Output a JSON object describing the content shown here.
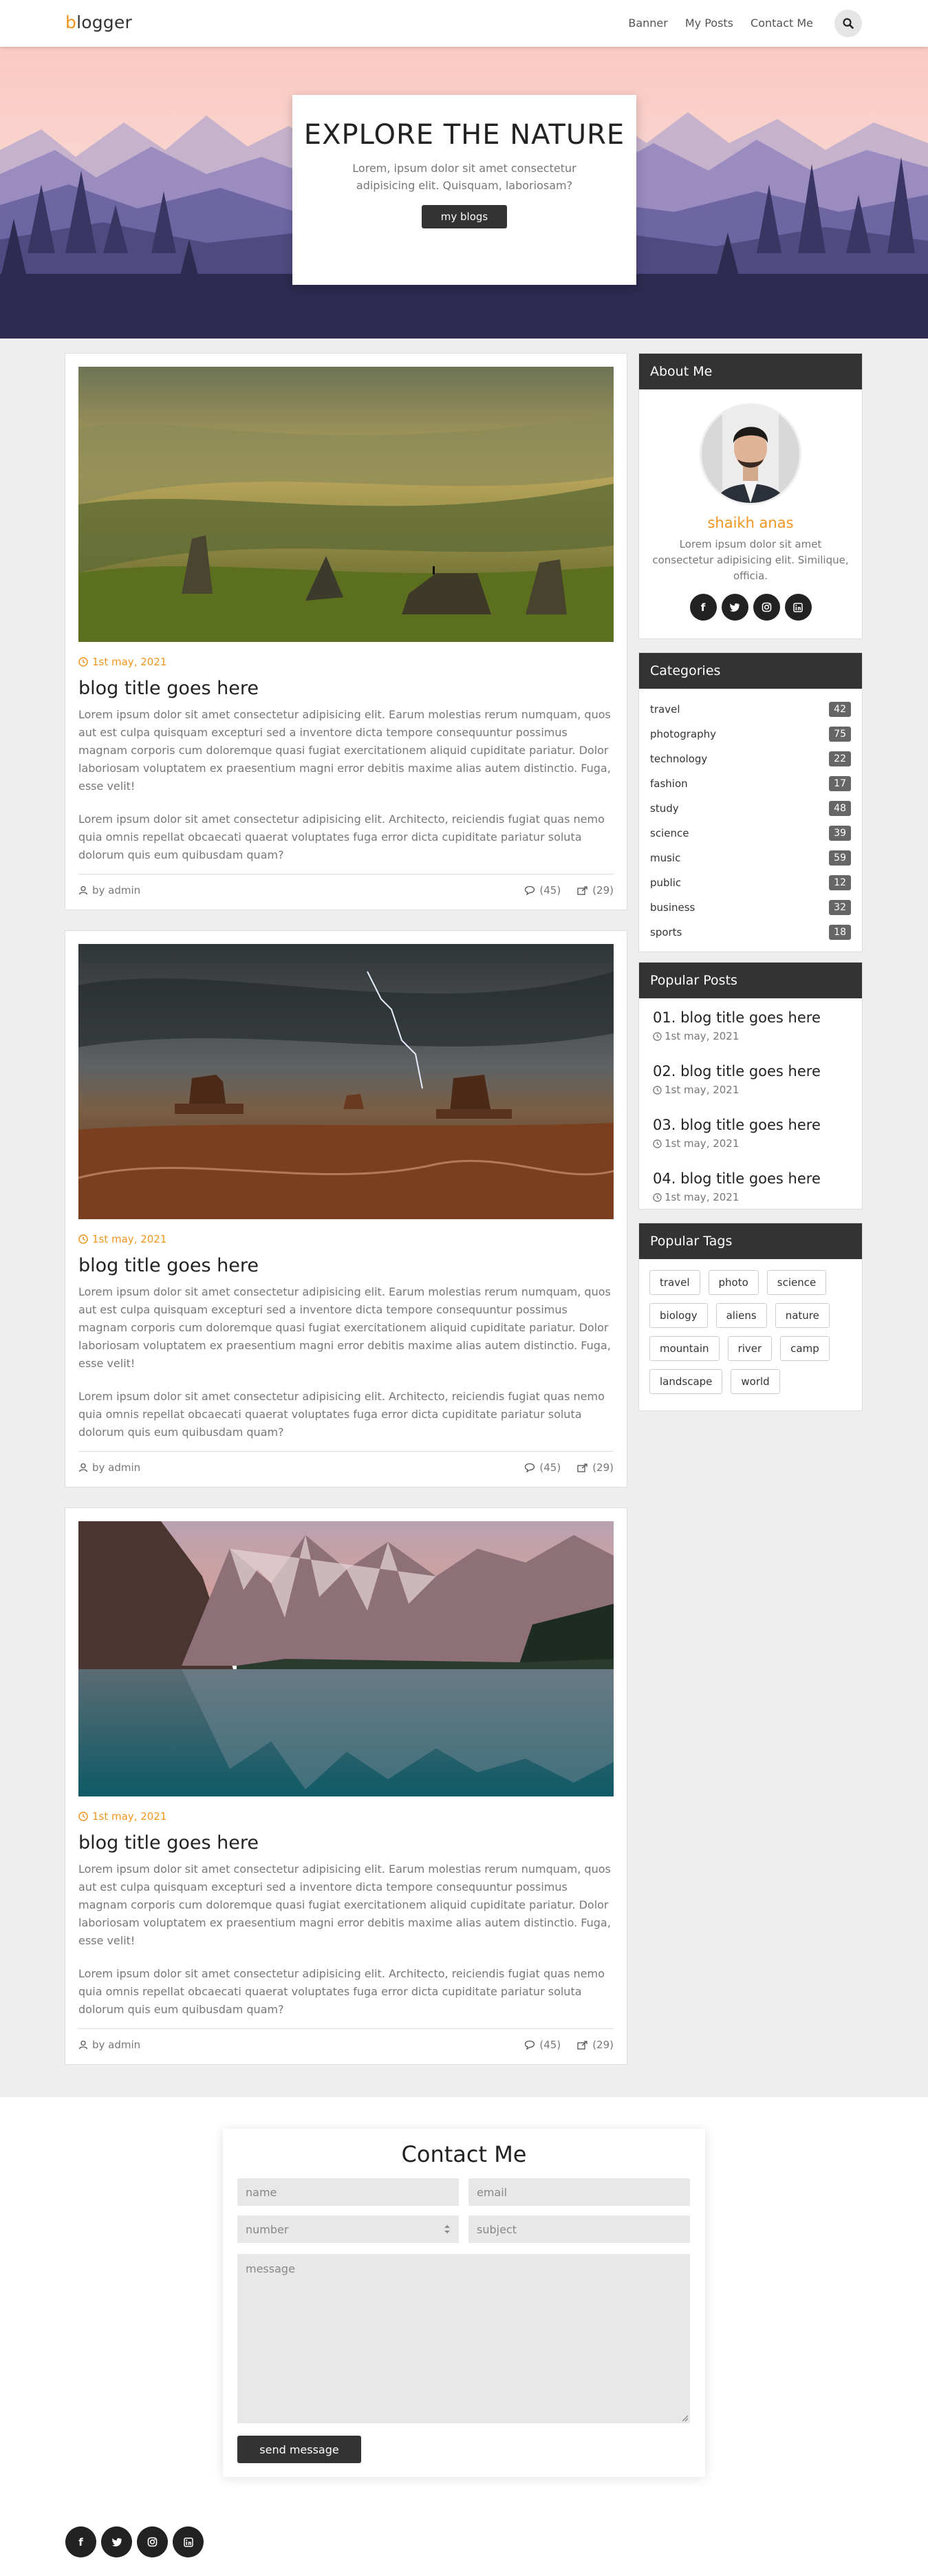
{
  "brand": {
    "first_letter": "b",
    "rest": "logger",
    "accent": "#f0961e"
  },
  "nav": {
    "links": [
      "Banner",
      "My Posts",
      "Contact Me"
    ],
    "search_icon": "search-icon"
  },
  "hero": {
    "title": "EXPLORE THE NATURE",
    "subtitle": "Lorem, ipsum dolor sit amet consectetur adipisicing elit. Quisquam, laboriosam?",
    "button": "my blogs"
  },
  "posts": [
    {
      "date": "1st may, 2021",
      "title": "blog title goes here",
      "p1": "Lorem ipsum dolor sit amet consectetur adipisicing elit. Earum molestias rerum numquam, quos aut est culpa quisquam excepturi sed a inventore dicta tempore consequuntur possimus magnam corporis cum doloremque quasi fugiat exercitationem aliquid cupiditate pariatur. Dolor laboriosam voluptatem ex praesentium magni error debitis maxime alias autem distinctio. Fuga, esse velit!",
      "p2": "Lorem ipsum dolor sit amet consectetur adipisicing elit. Architecto, reiciendis fugiat quas nemo quia omnis repellat obcaecati quaerat voluptates fuga error dicta cupiditate pariatur soluta dolorum quis eum quibusdam quam?",
      "author": "by admin",
      "comments": "(45)",
      "shares": "(29)",
      "image": "landscape-photo-valley"
    },
    {
      "date": "1st may, 2021",
      "title": "blog title goes here",
      "p1": "Lorem ipsum dolor sit amet consectetur adipisicing elit. Earum molestias rerum numquam, quos aut est culpa quisquam excepturi sed a inventore dicta tempore consequuntur possimus magnam corporis cum doloremque quasi fugiat exercitationem aliquid cupiditate pariatur. Dolor laboriosam voluptatem ex praesentium magni error debitis maxime alias autem distinctio. Fuga, esse velit!",
      "p2": "Lorem ipsum dolor sit amet consectetur adipisicing elit. Architecto, reiciendis fugiat quas nemo quia omnis repellat obcaecati quaerat voluptates fuga error dicta cupiditate pariatur soluta dolorum quis eum quibusdam quam?",
      "author": "by admin",
      "comments": "(45)",
      "shares": "(29)",
      "image": "desert-storm-photo"
    },
    {
      "date": "1st may, 2021",
      "title": "blog title goes here",
      "p1": "Lorem ipsum dolor sit amet consectetur adipisicing elit. Earum molestias rerum numquam, quos aut est culpa quisquam excepturi sed a inventore dicta tempore consequuntur possimus magnam corporis cum doloremque quasi fugiat exercitationem aliquid cupiditate pariatur. Dolor laboriosam voluptatem ex praesentium magni error debitis maxime alias autem distinctio. Fuga, esse velit!",
      "p2": "Lorem ipsum dolor sit amet consectetur adipisicing elit. Architecto, reiciendis fugiat quas nemo quia omnis repellat obcaecati quaerat voluptates fuga error dicta cupiditate pariatur soluta dolorum quis eum quibusdam quam?",
      "author": "by admin",
      "comments": "(45)",
      "shares": "(29)",
      "image": "mountain-lake-photo"
    }
  ],
  "about": {
    "heading": "About Me",
    "name": "shaikh anas",
    "text": "Lorem ipsum dolor sit amet consectetur adipisicing elit. Similique, officia.",
    "social": [
      "facebook-icon",
      "twitter-icon",
      "instagram-icon",
      "linkedin-icon"
    ]
  },
  "categories": {
    "heading": "Categories",
    "items": [
      {
        "name": "travel",
        "count": "42"
      },
      {
        "name": "photography",
        "count": "75"
      },
      {
        "name": "technology",
        "count": "22"
      },
      {
        "name": "fashion",
        "count": "17"
      },
      {
        "name": "study",
        "count": "48"
      },
      {
        "name": "science",
        "count": "39"
      },
      {
        "name": "music",
        "count": "59"
      },
      {
        "name": "public",
        "count": "12"
      },
      {
        "name": "business",
        "count": "32"
      },
      {
        "name": "sports",
        "count": "18"
      }
    ]
  },
  "popular_posts": {
    "heading": "Popular Posts",
    "items": [
      {
        "title": "01. blog title goes here",
        "date": "1st may, 2021"
      },
      {
        "title": "02. blog title goes here",
        "date": "1st may, 2021"
      },
      {
        "title": "03. blog title goes here",
        "date": "1st may, 2021"
      },
      {
        "title": "04. blog title goes here",
        "date": "1st may, 2021"
      }
    ]
  },
  "popular_tags": {
    "heading": "Popular Tags",
    "items": [
      "travel",
      "photo",
      "science",
      "biology",
      "aliens",
      "nature",
      "mountain",
      "river",
      "camp",
      "landscape",
      "world"
    ]
  },
  "contact": {
    "title": "Contact Me",
    "name_ph": "name",
    "email_ph": "email",
    "number_ph": "number",
    "subject_ph": "subject",
    "message_ph": "message",
    "button": "send message"
  },
  "footer": {
    "social": [
      "facebook-icon",
      "twitter-icon",
      "instagram-icon",
      "linkedin-icon"
    ]
  }
}
